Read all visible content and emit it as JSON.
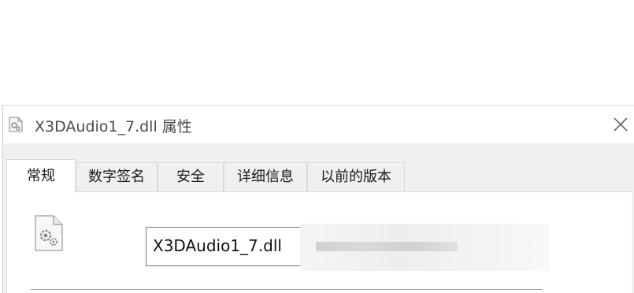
{
  "window": {
    "title": "X3DAudio1_7.dll 属性",
    "title_icon": "dll-file-icon",
    "close_icon": "close-icon"
  },
  "tabs": [
    {
      "label": "常规",
      "active": true
    },
    {
      "label": "数字签名",
      "active": false
    },
    {
      "label": "安全",
      "active": false
    },
    {
      "label": "详细信息",
      "active": false
    },
    {
      "label": "以前的版本",
      "active": false
    }
  ],
  "general": {
    "file_icon": "dll-gear-file-icon",
    "file_name": "X3DAudio1_7.dll"
  }
}
